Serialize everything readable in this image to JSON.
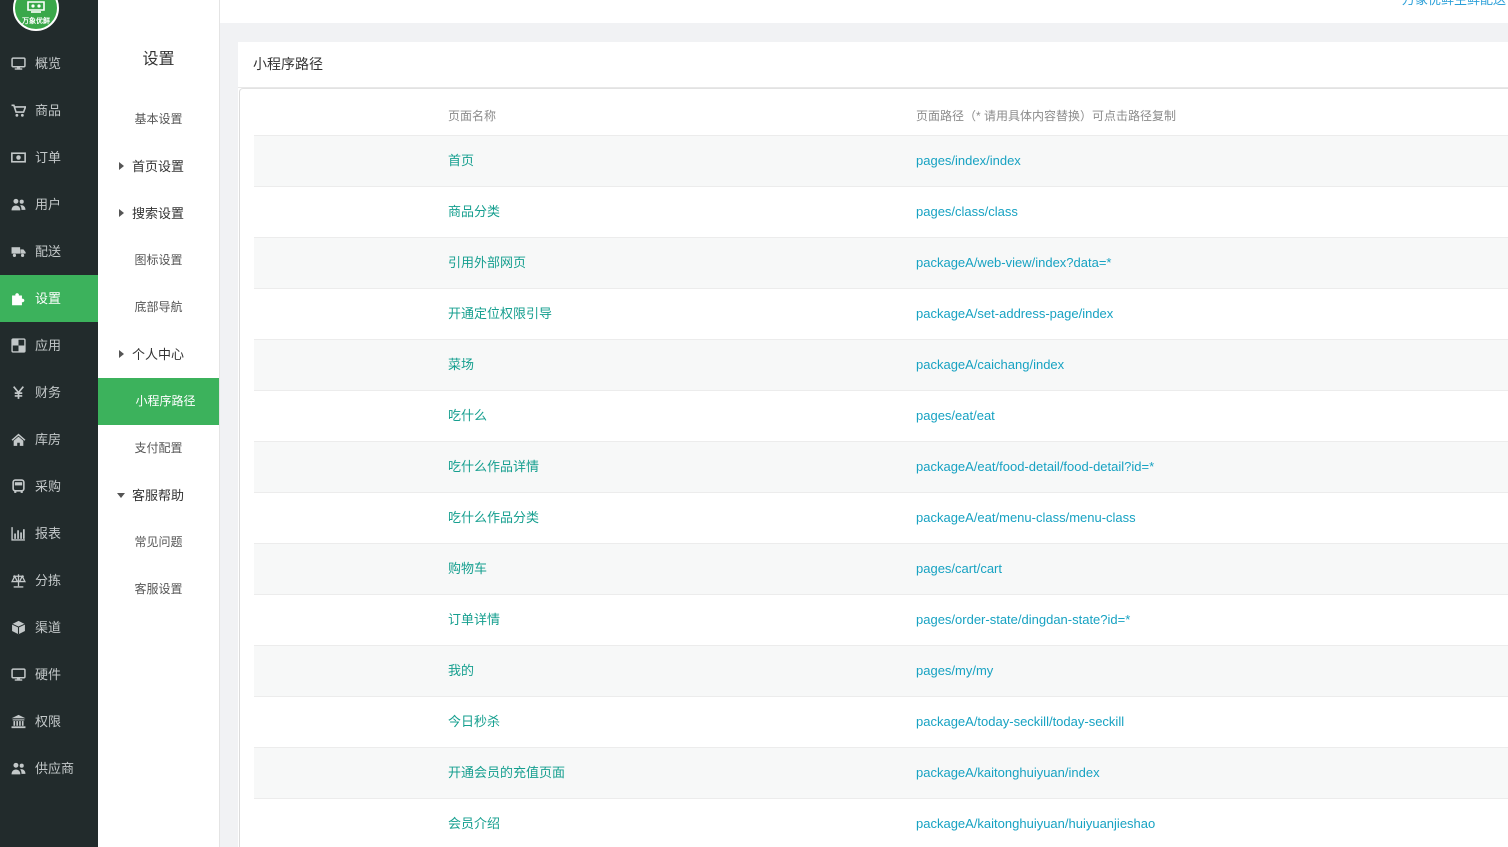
{
  "app": {
    "logo_text": "万象优鲜",
    "top_notice": "万象优鲜生鲜配送"
  },
  "colors": {
    "sidebar_bg": "#222b2c",
    "accent": "#3cb25c",
    "logo_green": "#3aa84a",
    "name_link": "#169f8f",
    "path_link": "#17a2c2",
    "notice": "#2a9fd8"
  },
  "nav": [
    {
      "label": "概览",
      "icon": "monitor-icon"
    },
    {
      "label": "商品",
      "icon": "cart-icon"
    },
    {
      "label": "订单",
      "icon": "money-icon"
    },
    {
      "label": "用户",
      "icon": "users-icon"
    },
    {
      "label": "配送",
      "icon": "truck-icon"
    },
    {
      "label": "设置",
      "icon": "puzzle-icon",
      "active": true
    },
    {
      "label": "应用",
      "icon": "apps-icon"
    },
    {
      "label": "财务",
      "icon": "yen-icon"
    },
    {
      "label": "库房",
      "icon": "home-icon"
    },
    {
      "label": "采购",
      "icon": "bus-icon"
    },
    {
      "label": "报表",
      "icon": "bar-chart-icon"
    },
    {
      "label": "分拣",
      "icon": "balance-scale-icon"
    },
    {
      "label": "渠道",
      "icon": "cube-icon"
    },
    {
      "label": "硬件",
      "icon": "desktop-icon"
    },
    {
      "label": "权限",
      "icon": "bank-icon"
    },
    {
      "label": "供应商",
      "icon": "users-icon"
    }
  ],
  "subnav": {
    "title": "设置",
    "items": [
      {
        "label": "基本设置"
      },
      {
        "label": "首页设置",
        "group": true,
        "expanded": false
      },
      {
        "label": "搜索设置",
        "group": true,
        "expanded": false
      },
      {
        "label": "图标设置"
      },
      {
        "label": "底部导航"
      },
      {
        "label": "个人中心",
        "group": true,
        "expanded": false
      },
      {
        "label": "小程序路径",
        "active": true
      },
      {
        "label": "支付配置"
      },
      {
        "label": "客服帮助",
        "group": true,
        "expanded": true
      },
      {
        "label": "常见问题"
      },
      {
        "label": "客服设置"
      }
    ]
  },
  "page": {
    "title": "小程序路径",
    "columns": {
      "name": "页面名称",
      "path": "页面路径（* 请用具体内容替换）可点击路径复制"
    },
    "rows": [
      {
        "name": "首页",
        "path": "pages/index/index"
      },
      {
        "name": "商品分类",
        "path": "pages/class/class"
      },
      {
        "name": "引用外部网页",
        "path": "packageA/web-view/index?data=*"
      },
      {
        "name": "开通定位权限引导",
        "path": "packageA/set-address-page/index"
      },
      {
        "name": "菜场",
        "path": "packageA/caichang/index"
      },
      {
        "name": "吃什么",
        "path": "pages/eat/eat"
      },
      {
        "name": "吃什么作品详情",
        "path": "packageA/eat/food-detail/food-detail?id=*"
      },
      {
        "name": "吃什么作品分类",
        "path": "packageA/eat/menu-class/menu-class"
      },
      {
        "name": "购物车",
        "path": "pages/cart/cart"
      },
      {
        "name": "订单详情",
        "path": "pages/order-state/dingdan-state?id=*"
      },
      {
        "name": "我的",
        "path": "pages/my/my"
      },
      {
        "name": "今日秒杀",
        "path": "packageA/today-seckill/today-seckill"
      },
      {
        "name": "开通会员的充值页面",
        "path": "packageA/kaitonghuiyuan/index"
      },
      {
        "name": "会员介绍",
        "path": "packageA/kaitonghuiyuan/huiyuanjieshao"
      }
    ]
  }
}
